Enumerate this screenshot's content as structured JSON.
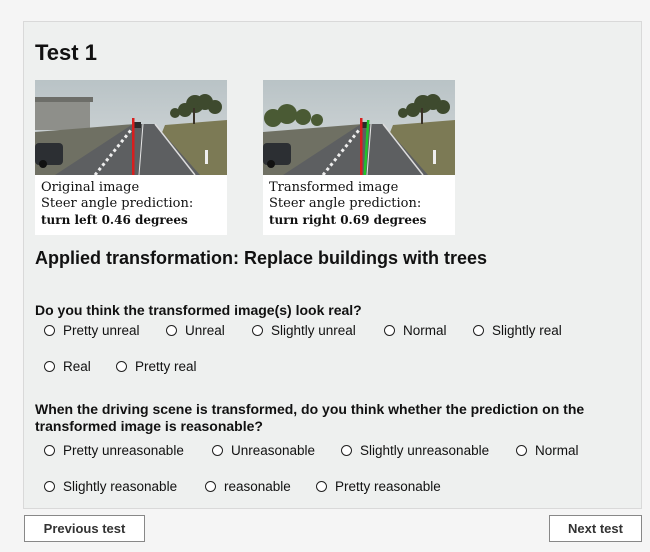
{
  "test": {
    "title": "Test 1"
  },
  "images": {
    "original": {
      "caption": "Original image",
      "prediction_label": "Steer angle prediction:",
      "prediction_value": "turn left 0.46 degrees"
    },
    "transformed": {
      "caption": "Transformed image",
      "prediction_label": "Steer angle prediction:",
      "prediction_value": "turn right 0.69 degrees"
    }
  },
  "transformation": {
    "text": "Applied transformation: Replace buildings with trees"
  },
  "question1": {
    "text": "Do you think the transformed image(s) look real?",
    "options": [
      "Pretty unreal",
      "Unreal",
      "Slightly unreal",
      "Normal",
      "Slightly real",
      "Real",
      "Pretty real"
    ]
  },
  "question2": {
    "text": "When the driving scene is transformed, do you think whether the prediction on the transformed image is reasonable?",
    "options": [
      "Pretty unreasonable",
      "Unreasonable",
      "Slightly unreasonable",
      "Normal",
      "Slightly reasonable",
      "reasonable",
      "Pretty reasonable"
    ]
  },
  "nav": {
    "previous_label": "Previous test",
    "next_label": "Next test"
  },
  "colors": {
    "prediction_original": "#d81e1e",
    "prediction_transformed": "#22c22a",
    "panel_bg": "#eef0ef"
  }
}
